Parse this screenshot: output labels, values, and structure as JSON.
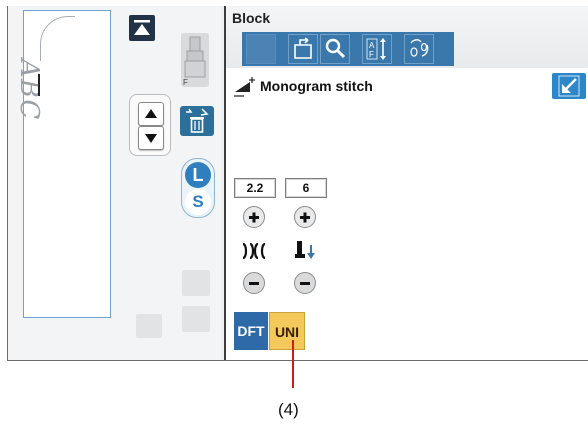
{
  "left_panel": {
    "text_preview": "ABC",
    "icons": [
      "go-to-top-icon",
      "presser-foot-icon",
      "trash-icon",
      "up-arrow-icon",
      "down-arrow-icon"
    ],
    "size_toggle": {
      "large_label": "L",
      "small_label": "S",
      "selected": "L"
    }
  },
  "right_panel": {
    "title": "Block",
    "toolbar_icons": [
      "open-file-icon",
      "magnify-icon",
      "mirror-flip-icon",
      "rotate-icon"
    ],
    "stitch_name": "Monogram stitch",
    "controls": {
      "width_value": "2.2",
      "length_value": "6"
    },
    "mode_buttons": {
      "dft": "DFT",
      "uni": "UNI",
      "selected": "UNI"
    }
  },
  "callout": {
    "label": "(4)"
  },
  "colors": {
    "toolbar_blue": "#3a78ac",
    "uni_yellow": "#f2c95a",
    "callout_red": "#d11a1a",
    "text_pane_border": "#6aa7cf"
  }
}
